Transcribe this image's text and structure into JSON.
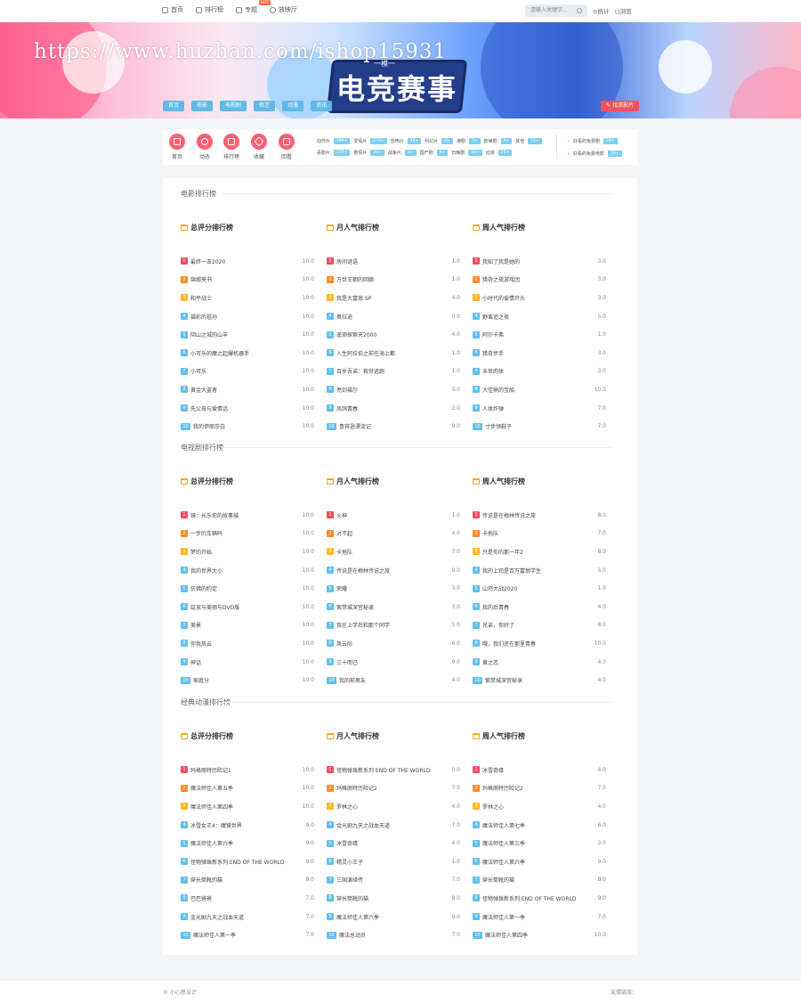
{
  "topnav": [
    {
      "label": "首页",
      "icon": "home-icon"
    },
    {
      "label": "排行榜",
      "icon": "list-icon"
    },
    {
      "label": "专题",
      "icon": "topic-icon",
      "badge": "HOT"
    },
    {
      "label": "放映厅",
      "icon": "play-icon"
    }
  ],
  "search": {
    "placeholder": "请输入关键字..."
  },
  "toplinks": [
    "统计",
    "浏览"
  ],
  "banner": {
    "watermark": "https://www.huzhan.com/ishop15931",
    "logo_text": "电竞赛事",
    "logo_sub": "一模一",
    "nav": [
      "首页",
      "电影",
      "电视剧",
      "综艺",
      "动漫",
      "资讯"
    ],
    "find_button": "找求影片"
  },
  "quick": [
    {
      "label": "首页",
      "icon": "home-icon"
    },
    {
      "label": "动态",
      "icon": "clock-icon"
    },
    {
      "label": "排行榜",
      "icon": "rank-icon"
    },
    {
      "label": "收藏",
      "icon": "star-icon"
    },
    {
      "label": "回看",
      "icon": "camera-icon"
    }
  ],
  "categories_row1": [
    {
      "name": "动作片",
      "count": "199+"
    },
    {
      "name": "爱情片",
      "count": "273+"
    },
    {
      "name": "恐怖片",
      "count": "46+"
    },
    {
      "name": "科幻片",
      "count": "9+"
    },
    {
      "name": "港剧",
      "count": "5+"
    },
    {
      "name": "欧美剧",
      "count": "9+"
    },
    {
      "name": "其他",
      "count": "12+"
    }
  ],
  "categories_row2": [
    {
      "name": "喜剧片",
      "count": "135+"
    },
    {
      "name": "剧情片",
      "count": "26+"
    },
    {
      "name": "战争片",
      "count": "3+"
    },
    {
      "name": "国产剧",
      "count": "9+"
    },
    {
      "name": "日韩剧",
      "count": "16+"
    },
    {
      "name": "动漫",
      "count": "25+"
    }
  ],
  "right_links": [
    {
      "label": "好看的免费剧",
      "count": "28+"
    },
    {
      "label": "好看的免费电影",
      "count": "29+"
    }
  ],
  "sections": [
    {
      "title": "电影排行榜",
      "columns": [
        {
          "head": "总评分排行榜",
          "items": [
            {
              "name": "最终一击2020",
              "score": "10.0"
            },
            {
              "name": "锦缎夹书",
              "score": "10.0"
            },
            {
              "name": "和平战士",
              "score": "10.0"
            },
            {
              "name": "福彩的祖孙",
              "score": "10.0"
            },
            {
              "name": "阴山之城的山羊",
              "score": "10.0"
            },
            {
              "name": "小可乐的魔之起爆机器手",
              "score": "10.0"
            },
            {
              "name": "小可乐",
              "score": "10.0"
            },
            {
              "name": "黄金大盗者",
              "score": "10.0"
            },
            {
              "name": "先父母与爱情话",
              "score": "10.0"
            },
            {
              "name": "我的伊丽莎白",
              "score": "10.0"
            }
          ]
        },
        {
          "head": "月人气排行榜",
          "items": [
            {
              "name": "房间谜语",
              "score": "1.0"
            },
            {
              "name": "万世王朝的回廊",
              "score": "1.0"
            },
            {
              "name": "我是大富翁 SP",
              "score": "4.0"
            },
            {
              "name": "奥拉逊",
              "score": "0.0"
            },
            {
              "name": "遥测探索天2000",
              "score": "4.0"
            },
            {
              "name": "人生阿拉伯之前往海上都",
              "score": "1.0"
            },
            {
              "name": "百岁吾弟：救世逃跑",
              "score": "1.0"
            },
            {
              "name": "亮剑福尔",
              "score": "5.0"
            },
            {
              "name": "凤鸽青春",
              "score": "2.0"
            },
            {
              "name": "鲁宾逊漂流记",
              "score": "9.0"
            }
          ]
        },
        {
          "head": "周人气排行榜",
          "items": [
            {
              "name": "我知了我是她的",
              "score": "3.0"
            },
            {
              "name": "猎奇之夜游戏团",
              "score": "3.0"
            },
            {
              "name": "小时代的爱情开头",
              "score": "3.0"
            },
            {
              "name": "野蛮追之夜",
              "score": "5.0"
            },
            {
              "name": "阿尔卡弗",
              "score": "1.0"
            },
            {
              "name": "猎奇步手",
              "score": "3.0"
            },
            {
              "name": "未世肉体",
              "score": "3.0"
            },
            {
              "name": "大佳鼎的宝船",
              "score": "10.0"
            },
            {
              "name": "人体炸弹",
              "score": "7.0"
            },
            {
              "name": "寸步领鞋子",
              "score": "7.0"
            }
          ]
        }
      ]
    },
    {
      "title": "电视剧排行榜",
      "columns": [
        {
          "head": "总评分排行榜",
          "items": [
            {
              "name": "镜：长乐你的故事城",
              "score": "10.0"
            },
            {
              "name": "一步的车辆吗",
              "score": "10.0"
            },
            {
              "name": "梦的开始",
              "score": "10.0"
            },
            {
              "name": "我的世界大小",
              "score": "10.0"
            },
            {
              "name": "仿佛的约定",
              "score": "10.0"
            },
            {
              "name": "绽放与美丽与DVD版",
              "score": "10.0"
            },
            {
              "name": "美景",
              "score": "10.0"
            },
            {
              "name": "你我风云",
              "score": "10.0"
            },
            {
              "name": "神话",
              "score": "10.0"
            },
            {
              "name": "家庭分",
              "score": "10.0"
            }
          ]
        },
        {
          "head": "月人气排行榜",
          "items": [
            {
              "name": "火神",
              "score": "1.0"
            },
            {
              "name": "对不起",
              "score": "4.0"
            },
            {
              "name": "卡拖队",
              "score": "7.0"
            },
            {
              "name": "传说是在梅林传说之旅",
              "score": "9.0"
            },
            {
              "name": "荣耀",
              "score": "3.0"
            },
            {
              "name": "紫禁城深宫秘录",
              "score": "3.0"
            },
            {
              "name": "我在上学后和那个同学",
              "score": "5.0"
            },
            {
              "name": "风云际",
              "score": "6.0"
            },
            {
              "name": "三十而已",
              "score": "9.0"
            },
            {
              "name": "我的前男友",
              "score": "4.0"
            }
          ]
        },
        {
          "head": "周人气排行榜",
          "items": [
            {
              "name": "传说是在梅林传说之旅",
              "score": "8.0"
            },
            {
              "name": "卡拖队",
              "score": "7.0"
            },
            {
              "name": "只是你的那一年2",
              "score": "8.0"
            },
            {
              "name": "我的上司是百万富翁学生",
              "score": "5.0"
            },
            {
              "name": "山鸡大战2020",
              "score": "1.0"
            },
            {
              "name": "我的后青春",
              "score": "4.0"
            },
            {
              "name": "兄弟，你好了",
              "score": "8.0"
            },
            {
              "name": "哦，我们还在那里青春",
              "score": "10.0"
            },
            {
              "name": "黄之恋",
              "score": "4.0"
            },
            {
              "name": "紫禁城深宫秘录",
              "score": "4.0"
            }
          ]
        }
      ]
    },
    {
      "title": "经典动漫排行榜",
      "columns": [
        {
          "head": "总评分排行榜",
          "items": [
            {
              "name": "玛格丽特历险记1",
              "score": "10.0"
            },
            {
              "name": "魔法师佳人第五季",
              "score": "10.0"
            },
            {
              "name": "魔法师佳人第四季",
              "score": "10.0"
            },
            {
              "name": "冰雪女王4：魔镜世界",
              "score": "9.0"
            },
            {
              "name": "魔法师佳人第六季",
              "score": "9.0"
            },
            {
              "name": "怪物弹珠新系列 END OF THE WORLD",
              "score": "9.0"
            },
            {
              "name": "穿长筒靴的猫",
              "score": "8.0"
            },
            {
              "name": "巴巴爸爸",
              "score": "7.0"
            },
            {
              "name": "金光剧九天之战血天道",
              "score": "7.0"
            },
            {
              "name": "魔法师佳人第一季",
              "score": "7.0"
            }
          ]
        },
        {
          "head": "月人气排行榜",
          "items": [
            {
              "name": "怪物弹珠新系列 END OF THE WORLD",
              "score": "0.0"
            },
            {
              "name": "玛格丽特历险记2",
              "score": "7.0"
            },
            {
              "name": "罗林之心",
              "score": "4.0"
            },
            {
              "name": "金光剧九天之战血天道",
              "score": "7.0"
            },
            {
              "name": "冰雪奇缘",
              "score": "4.0"
            },
            {
              "name": "精灵小王子",
              "score": "1.0"
            },
            {
              "name": "三国演绎传",
              "score": "7.0"
            },
            {
              "name": "穿长筒靴的猫",
              "score": "8.0"
            },
            {
              "name": "魔法师佳人第六季",
              "score": "9.0"
            },
            {
              "name": "魔法总动员",
              "score": "7.0"
            }
          ]
        },
        {
          "head": "周人气排行榜",
          "items": [
            {
              "name": "冰雪奇缘",
              "score": "4.0"
            },
            {
              "name": "玛格丽特历险记2",
              "score": "7.0"
            },
            {
              "name": "罗林之心",
              "score": "4.0"
            },
            {
              "name": "魔法师佳人第七季",
              "score": "6.0"
            },
            {
              "name": "魔法师佳人第三季",
              "score": "3.0"
            },
            {
              "name": "魔法师佳人第六季",
              "score": "9.0"
            },
            {
              "name": "穿长筒靴的猫",
              "score": "8.0"
            },
            {
              "name": "怪物弹珠新系列 END OF THE WORLD",
              "score": "9.0"
            },
            {
              "name": "魔法师佳人第一季",
              "score": "7.0"
            },
            {
              "name": "魔法师佳人第四季",
              "score": "10.0"
            }
          ]
        }
      ]
    }
  ],
  "footer": {
    "copyright": "© 小心思设计",
    "friend_links": "友情链接："
  }
}
